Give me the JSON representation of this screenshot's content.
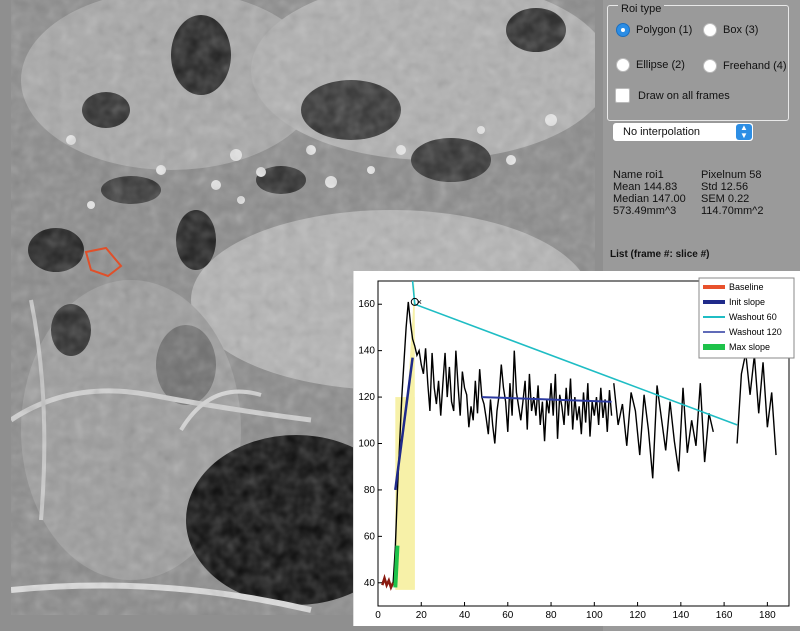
{
  "roi_panel": {
    "title": "Roi type",
    "options": [
      "Polygon (1)",
      "Box (3)",
      "Ellipse (2)",
      "Freehand (4)"
    ],
    "selected": "Polygon (1)",
    "draw_all_frames_label": "Draw on all frames",
    "draw_all_frames_checked": false
  },
  "interpolation": {
    "value": "No interpolation"
  },
  "stats": {
    "name": "Name roi1",
    "pixelnum": "Pixelnum 58",
    "mean": "Mean 144.83",
    "std": "Std 12.56",
    "median": "Median 147.00",
    "sem": "SEM 0.22",
    "volume": "573.49mm^3",
    "area": "114.70mm^2"
  },
  "list_label": "List (frame #: slice #)",
  "colors": {
    "roi_outline": "#e0502a",
    "radio_selected": "#2b8de5",
    "baseline": "#e8512c",
    "init_slope": "#1f2a8a",
    "washout60": "#1fbdc4",
    "washout120": "#2c3aa0",
    "max_slope": "#1ec24a",
    "signal": "#000000",
    "shade": "#f7f1a8"
  },
  "chart_data": {
    "type": "line",
    "xlim": [
      0,
      190
    ],
    "ylim": [
      30,
      170
    ],
    "xticks": [
      0,
      20,
      40,
      60,
      80,
      100,
      120,
      140,
      160,
      180
    ],
    "yticks": [
      40,
      60,
      80,
      100,
      120,
      140,
      160
    ],
    "legend_position": "top-right",
    "legend": [
      "Baseline",
      "Init slope",
      "Washout 60",
      "Washout 120",
      "Max slope"
    ],
    "signal": {
      "x": [
        2,
        3,
        4,
        5,
        6,
        7,
        8,
        9,
        10,
        11,
        12,
        13,
        14,
        15,
        16,
        17,
        18,
        19,
        20,
        21,
        22,
        23,
        24,
        25,
        26,
        27,
        28,
        29,
        30,
        31,
        32,
        33,
        34,
        35,
        36,
        37,
        38,
        39,
        40,
        41,
        42,
        43,
        44,
        45,
        46,
        47,
        48,
        49,
        50,
        51,
        52,
        53,
        54,
        55,
        56,
        57,
        58,
        59,
        60,
        61,
        62,
        63,
        64,
        65,
        66,
        67,
        68,
        69,
        70,
        71,
        72,
        73,
        74,
        75,
        76,
        77,
        78,
        79,
        80,
        81,
        82,
        83,
        84,
        85,
        86,
        87,
        88,
        89,
        90,
        91,
        92,
        93,
        94,
        95,
        96,
        97,
        98,
        99,
        100,
        101,
        102,
        103,
        104,
        105,
        106,
        107,
        108
      ],
      "y": [
        40,
        42,
        39,
        41,
        38,
        40,
        55,
        80,
        100,
        120,
        135,
        150,
        161,
        152,
        145,
        142,
        138,
        140,
        134,
        130,
        141,
        126,
        114,
        139,
        124,
        117,
        127,
        112,
        126,
        139,
        120,
        133,
        118,
        114,
        140,
        125,
        112,
        131,
        124,
        121,
        107,
        116,
        110,
        127,
        113,
        132,
        120,
        117,
        111,
        104,
        119,
        108,
        100,
        114,
        121,
        134,
        124,
        118,
        105,
        126,
        112,
        140,
        122,
        116,
        110,
        118,
        127,
        106,
        130,
        114,
        120,
        112,
        125,
        108,
        118,
        101,
        119,
        113,
        126,
        112,
        130,
        102,
        121,
        116,
        108,
        124,
        112,
        128,
        106,
        120,
        110,
        116,
        104,
        122,
        109,
        126,
        103,
        118,
        112,
        120,
        108,
        124,
        111,
        119,
        105,
        123,
        112
      ]
    },
    "signal2": {
      "x": [
        109,
        111,
        113,
        115,
        117,
        119,
        121,
        123,
        125,
        127,
        129,
        131,
        133,
        135,
        137,
        139,
        141,
        143,
        145,
        147,
        149,
        151,
        153,
        155
      ],
      "y": [
        126,
        108,
        117,
        99,
        122,
        114,
        95,
        121,
        106,
        85,
        125,
        111,
        97,
        118,
        101,
        88,
        124,
        96,
        110,
        99,
        126,
        92,
        113,
        105
      ]
    },
    "signal3": {
      "x": [
        166,
        168,
        170,
        172,
        174,
        176,
        178,
        180,
        182,
        184
      ],
      "y": [
        100,
        130,
        139,
        121,
        138,
        113,
        135,
        107,
        122,
        95
      ]
    },
    "baseline": {
      "x": [
        2,
        3,
        4,
        5,
        6,
        7
      ],
      "y": [
        39,
        42,
        39,
        41,
        38,
        40
      ]
    },
    "init_slope": {
      "x": [
        8,
        16
      ],
      "y": [
        80,
        137
      ]
    },
    "max_slope": {
      "x": [
        8,
        9
      ],
      "y": [
        38,
        56
      ]
    },
    "washout60": {
      "x": [
        16,
        17,
        166
      ],
      "y": [
        170,
        160,
        108
      ]
    },
    "washout120": {
      "x": [
        48,
        108
      ],
      "y": [
        120,
        118
      ]
    },
    "peak_marker": {
      "x": 17,
      "y": 161
    },
    "shaded_x": [
      8,
      17
    ]
  }
}
